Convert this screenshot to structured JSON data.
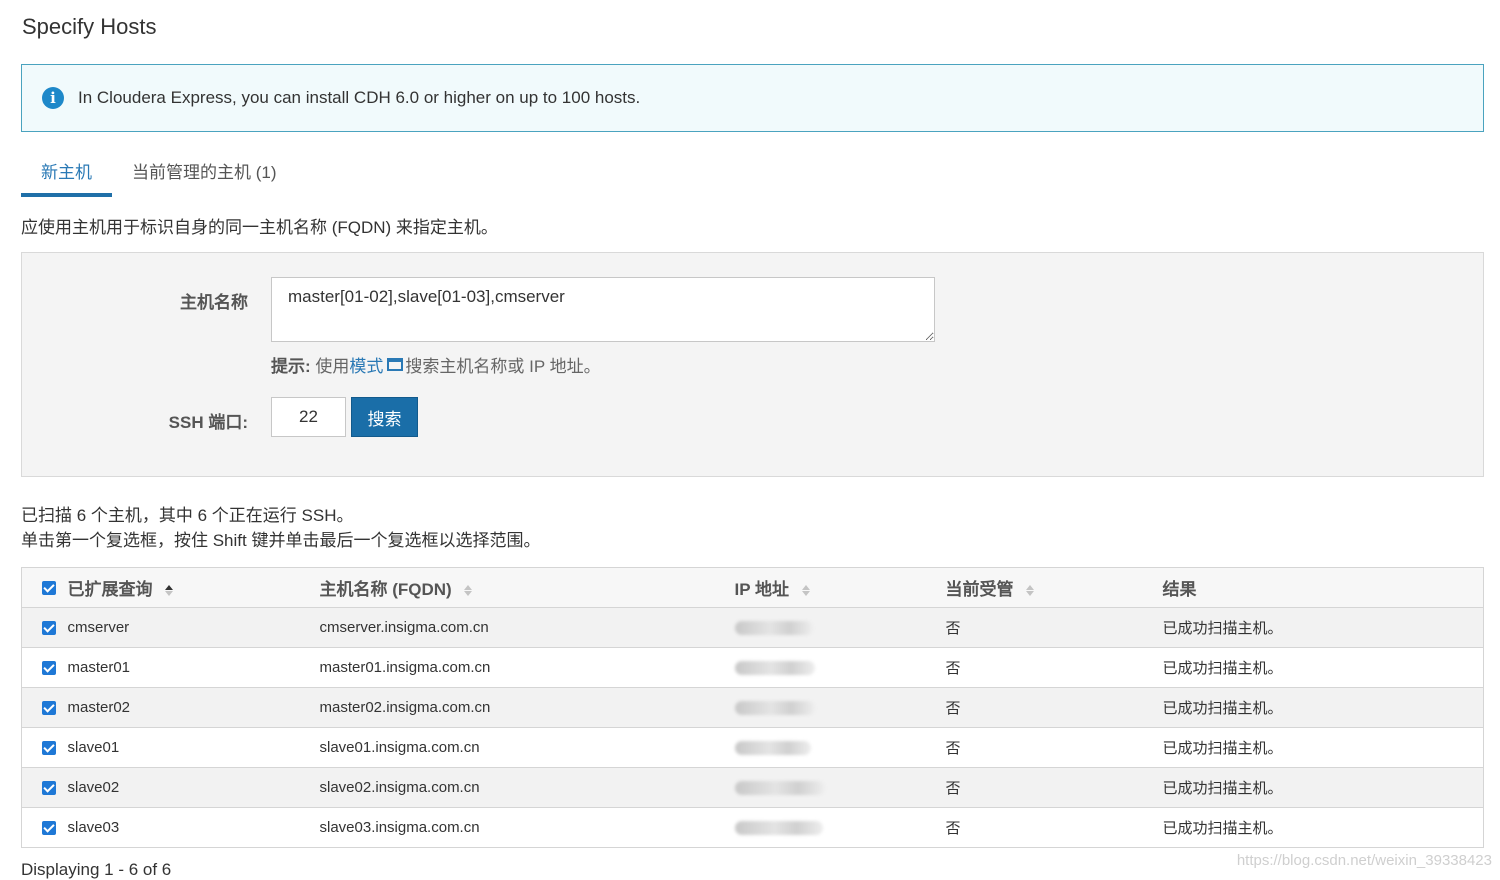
{
  "page": {
    "title": "Specify Hosts"
  },
  "info": {
    "icon": "info-icon",
    "text": "In Cloudera Express, you can install CDH 6.0 or higher on up to 100 hosts."
  },
  "tabs": [
    {
      "label": "新主机",
      "active": true
    },
    {
      "label": "当前管理的主机 (1)",
      "active": false
    }
  ],
  "description": "应使用主机用于标识自身的同一主机名称 (FQDN) 来指定主机。",
  "form": {
    "hostname_label": "主机名称",
    "hostname_value": "master[01-02],slave[01-03],cmserver",
    "hint_label": "提示:",
    "hint_prefix": " 使用",
    "hint_link": "模式",
    "hint_suffix": "搜索主机名称或 IP 地址。",
    "ssh_port_label": "SSH 端口:",
    "ssh_port_value": "22",
    "search_button": "搜索"
  },
  "scan": {
    "summary": "已扫描 6 个主机，其中 6 个正在运行 SSH。",
    "shift_hint": "单击第一个复选框，按住 Shift 键并单击最后一个复选框以选择范围。"
  },
  "table": {
    "headers": {
      "expanded_query": "已扩展查询",
      "hostname_fqdn": "主机名称 (FQDN)",
      "ip_address": "IP 地址",
      "currently_managed": "当前受管",
      "result": "结果"
    },
    "rows": [
      {
        "checked": true,
        "query": "cmserver",
        "fqdn": "cmserver.insigma.com.cn",
        "managed": "否",
        "result": "已成功扫描主机。"
      },
      {
        "checked": true,
        "query": "master01",
        "fqdn": "master01.insigma.com.cn",
        "managed": "否",
        "result": "已成功扫描主机。"
      },
      {
        "checked": true,
        "query": "master02",
        "fqdn": "master02.insigma.com.cn",
        "managed": "否",
        "result": "已成功扫描主机。"
      },
      {
        "checked": true,
        "query": "slave01",
        "fqdn": "slave01.insigma.com.cn",
        "managed": "否",
        "result": "已成功扫描主机。"
      },
      {
        "checked": true,
        "query": "slave02",
        "fqdn": "slave02.insigma.com.cn",
        "managed": "否",
        "result": "已成功扫描主机。"
      },
      {
        "checked": true,
        "query": "slave03",
        "fqdn": "slave03.insigma.com.cn",
        "managed": "否",
        "result": "已成功扫描主机。"
      }
    ]
  },
  "paging": {
    "text": "Displaying 1 - 6 of 6"
  },
  "watermark": "https://blog.csdn.net/weixin_39338423",
  "colors": {
    "accent": "#1a6ea8",
    "tab_active": "#2a79b5",
    "info_border": "#4aa3bf",
    "info_bg": "#f1fafc"
  }
}
